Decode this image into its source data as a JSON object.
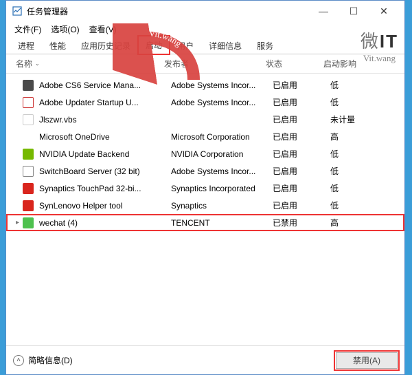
{
  "window": {
    "title": "任务管理器",
    "controls": {
      "min": "—",
      "max": "☐",
      "close": "✕"
    }
  },
  "menubar": [
    {
      "label": "文件(F)"
    },
    {
      "label": "选项(O)"
    },
    {
      "label": "查看(V)"
    }
  ],
  "tabs": [
    {
      "label": "进程"
    },
    {
      "label": "性能"
    },
    {
      "label": "应用历史记录"
    },
    {
      "label": "启动",
      "selected": true,
      "highlight": true
    },
    {
      "label": "用户"
    },
    {
      "label": "详细信息"
    },
    {
      "label": "服务"
    }
  ],
  "columns": {
    "name": "名称",
    "publisher": "发布者",
    "status": "状态",
    "impact": "启动影响"
  },
  "rows": [
    {
      "icon": "ic-adobe1",
      "name": "Adobe CS6 Service Mana...",
      "publisher": "Adobe Systems Incor...",
      "status": "已启用",
      "impact": "低"
    },
    {
      "icon": "ic-adobe2",
      "name": "Adobe Updater Startup U...",
      "publisher": "Adobe Systems Incor...",
      "status": "已启用",
      "impact": "低"
    },
    {
      "icon": "ic-file",
      "name": "Jlszwr.vbs",
      "publisher": "",
      "status": "已启用",
      "impact": "未计量"
    },
    {
      "icon": "ic-onedrive",
      "glyph": "☁",
      "name": "Microsoft OneDrive",
      "publisher": "Microsoft Corporation",
      "status": "已启用",
      "impact": "高"
    },
    {
      "icon": "ic-nvidia",
      "name": "NVIDIA Update Backend",
      "publisher": "NVIDIA Corporation",
      "status": "已启用",
      "impact": "低"
    },
    {
      "icon": "ic-sb",
      "glyph": "S",
      "name": "SwitchBoard Server (32 bit)",
      "publisher": "Adobe Systems Incor...",
      "status": "已启用",
      "impact": "低"
    },
    {
      "icon": "ic-syn",
      "name": "Synaptics TouchPad 32-bi...",
      "publisher": "Synaptics Incorporated",
      "status": "已启用",
      "impact": "低"
    },
    {
      "icon": "ic-syn2",
      "name": "SynLenovo Helper tool",
      "publisher": "Synaptics",
      "status": "已启用",
      "impact": "低"
    },
    {
      "icon": "ic-wechat",
      "name": "wechat (4)",
      "publisher": "TENCENT",
      "status": "已禁用",
      "impact": "高",
      "expandable": true,
      "highlight": true
    }
  ],
  "statusbar": {
    "fewer": "简略信息(D)",
    "action": "禁用(A)"
  },
  "watermark": {
    "top": "微IT",
    "bottom": "Vit.wang"
  },
  "arrow_label": "Vit.wang"
}
